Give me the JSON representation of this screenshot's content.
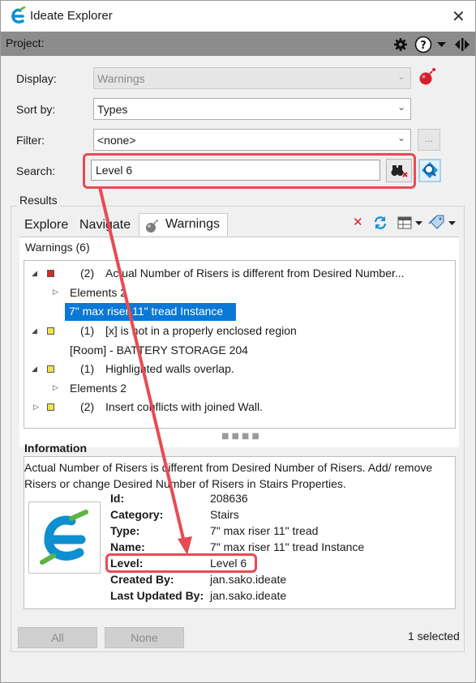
{
  "window": {
    "title": "Ideate Explorer",
    "close_glyph": "✕",
    "app_icon": "ideate-e-logo"
  },
  "project_bar": {
    "label": "Project:",
    "icons": [
      "gear-icon",
      "help-icon",
      "dropdown-icon",
      "collapse-icon"
    ]
  },
  "form": {
    "display": {
      "label": "Display:",
      "value": "Warnings"
    },
    "sort_by": {
      "label": "Sort by:",
      "value": "Types"
    },
    "filter": {
      "label": "Filter:",
      "value": "<none>",
      "button": "..."
    },
    "search": {
      "label": "Search:",
      "value": "Level 6"
    }
  },
  "results": {
    "group_label": "Results",
    "tabs": [
      {
        "label": "Explore"
      },
      {
        "label": "Navigate"
      },
      {
        "label": "Warnings"
      }
    ],
    "list_header": "Warnings (6)",
    "tree": [
      {
        "level": 0,
        "expanded": true,
        "color": "#d62a2a",
        "count": "(2)",
        "text": "Actual Number of Risers is different from Desired Number..."
      },
      {
        "level": 1,
        "expanded": false,
        "text": "Elements 2"
      },
      {
        "level": 2,
        "selected": true,
        "text": "7\" max riser 11\" tread Instance"
      },
      {
        "level": 0,
        "expanded": true,
        "color": "#f2e24a",
        "count": "(1)",
        "text": "[x] is not in a properly enclosed region"
      },
      {
        "level": 1,
        "text": "[Room] - BATTERY STORAGE 204"
      },
      {
        "level": 0,
        "expanded": true,
        "color": "#f2e24a",
        "count": "(1)",
        "text": "Highlighted walls overlap."
      },
      {
        "level": 1,
        "expanded": false,
        "text": "Elements 2"
      },
      {
        "level": 0,
        "expanded": false,
        "color": "#f2e24a",
        "count": "(2)",
        "text": "Insert conflicts with joined Wall."
      }
    ]
  },
  "information": {
    "title": "Information",
    "description": "Actual Number of Risers is different from Desired Number of Risers. Add/ remove Risers or change Desired Number of Risers in Stairs Properties.",
    "properties": [
      {
        "label": "Id:",
        "value": "208636"
      },
      {
        "label": "Category:",
        "value": "Stairs"
      },
      {
        "label": "Type:",
        "value": "7\" max riser 11\" tread"
      },
      {
        "label": "Name:",
        "value": "7\" max riser 11\" tread Instance"
      },
      {
        "label": "Level:",
        "value": "Level 6"
      },
      {
        "label": "Created  By:",
        "value": "jan.sako.ideate"
      },
      {
        "label": "Last Updated By:",
        "value": "jan.sako.ideate"
      }
    ]
  },
  "footer": {
    "all_label": "All",
    "none_label": "None",
    "selected_text": "1 selected"
  },
  "colors": {
    "accent": "#0a78d7",
    "annotation": "#e84b53",
    "logo_blue": "#0d8fd0",
    "logo_green": "#5bb443"
  }
}
